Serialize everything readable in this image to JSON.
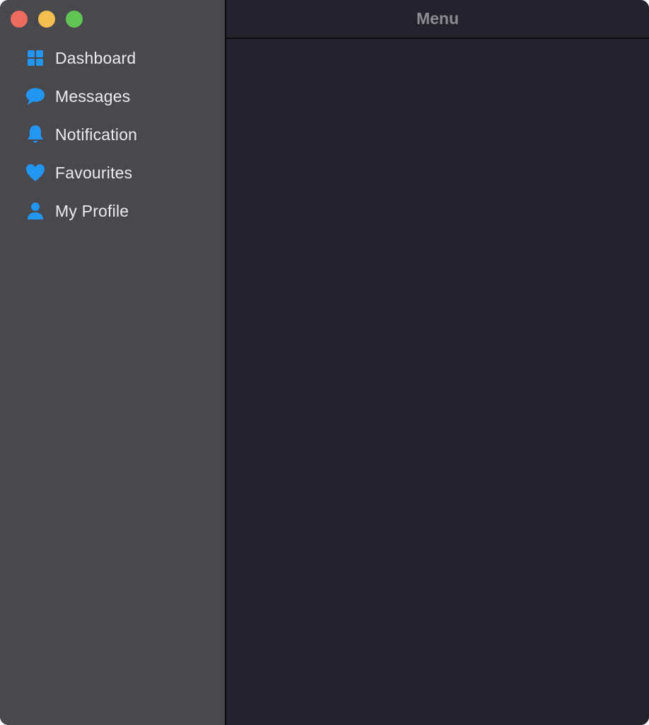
{
  "window": {
    "controls": [
      {
        "name": "close",
        "color": "#ed6a5e"
      },
      {
        "name": "minimize",
        "color": "#f5bf4f"
      },
      {
        "name": "maximize",
        "color": "#61c554"
      }
    ]
  },
  "header": {
    "title": "Menu"
  },
  "sidebar": {
    "accent_color": "#2196f3",
    "items": [
      {
        "label": "Dashboard",
        "icon": "grid-icon"
      },
      {
        "label": "Messages",
        "icon": "chat-bubble-icon"
      },
      {
        "label": "Notification",
        "icon": "bell-icon"
      },
      {
        "label": "Favourites",
        "icon": "heart-icon"
      },
      {
        "label": "My Profile",
        "icon": "person-icon"
      }
    ]
  }
}
